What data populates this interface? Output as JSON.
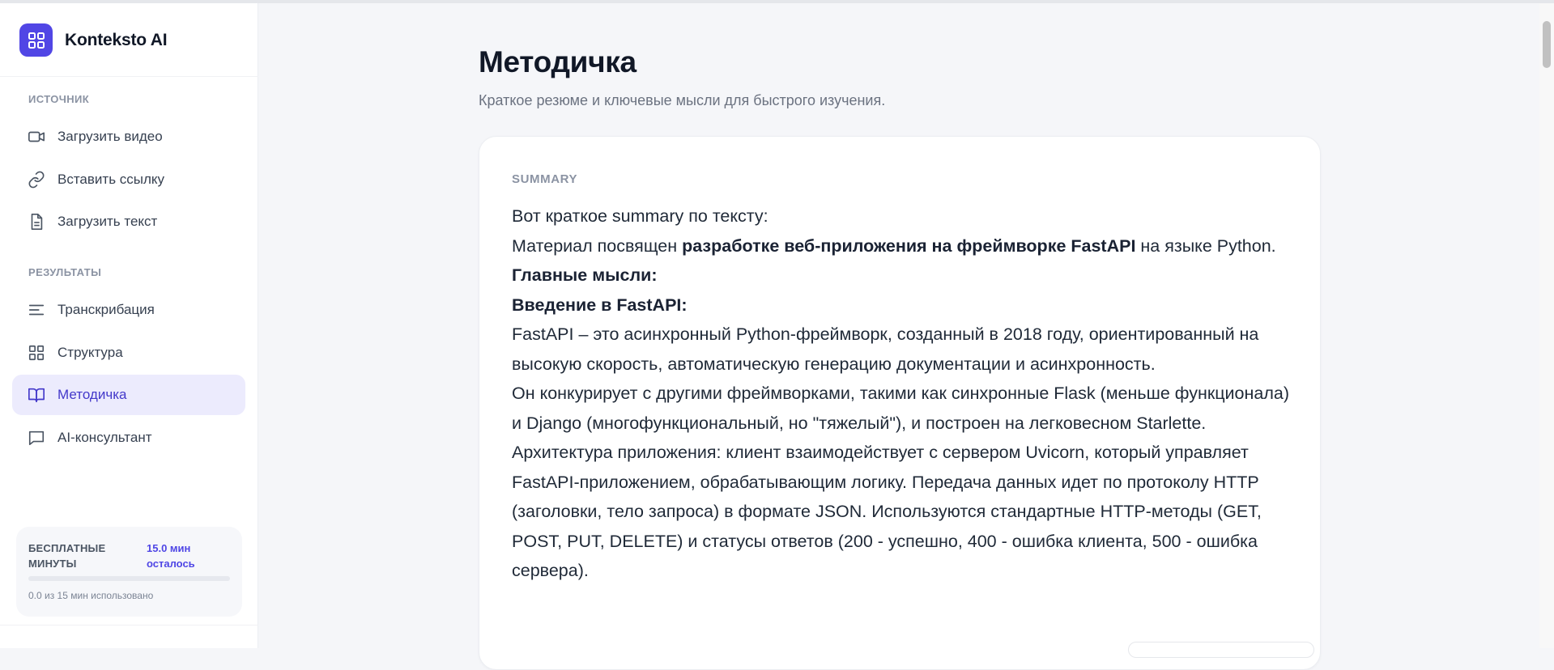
{
  "app": {
    "name": "Konteksto AI"
  },
  "sidebar": {
    "sections": [
      {
        "label": "ИСТОЧНИК",
        "items": [
          {
            "label": "Загрузить видео",
            "icon": "video-camera-icon"
          },
          {
            "label": "Вставить ссылку",
            "icon": "link-icon"
          },
          {
            "label": "Загрузить текст",
            "icon": "document-icon"
          }
        ]
      },
      {
        "label": "РЕЗУЛЬТАТЫ",
        "items": [
          {
            "label": "Транскрибация",
            "icon": "lines-icon"
          },
          {
            "label": "Структура",
            "icon": "grid-icon"
          },
          {
            "label": "Методичка",
            "icon": "book-icon",
            "active": true
          },
          {
            "label": "AI-консультант",
            "icon": "chat-icon"
          }
        ]
      }
    ],
    "minutes": {
      "title": "БЕСПЛАТНЫЕ МИНУТЫ",
      "left": "15.0 мин осталось",
      "used": "0.0 из 15 мин использовано",
      "progress": 0
    }
  },
  "main": {
    "title": "Методичка",
    "subtitle": "Краткое резюме и ключевые мысли для быстрого изучения.",
    "card": {
      "label": "SUMMARY",
      "line1": "Вот краткое summary по тексту:",
      "line2_pre": "Материал посвящен ",
      "line2_bold": "разработке веб-приложения на фреймворке FastAPI",
      "line2_post": " на языке Python.",
      "heading1": "Главные мысли:",
      "heading2": "Введение в FastAPI:",
      "para1": "FastAPI – это асинхронный Python-фреймворк, созданный в 2018 году, ориентированный на высокую скорость, автоматическую генерацию документации и асинхронность.",
      "para2": "Он конкурирует с другими фреймворками, такими как синхронные Flask (меньше функционала) и Django (многофункциональный, но \"тяжелый\"), и построен на легковесном Starlette.",
      "para3": "Архитектура приложения: клиент взаимодействует с сервером Uvicorn, который управляет FastAPI-приложением, обрабатывающим логику. Передача данных идет по протоколу HTTP (заголовки, тело запроса) в формате JSON. Используются стандартные HTTP-методы (GET, POST, PUT, DELETE) и статусы ответов (200 - успешно, 400 - ошибка клиента, 500 - ошибка сервера)."
    }
  },
  "colors": {
    "accent": "#5146e5",
    "active_bg": "#ecebfd",
    "page_bg": "#f5f6f9"
  }
}
